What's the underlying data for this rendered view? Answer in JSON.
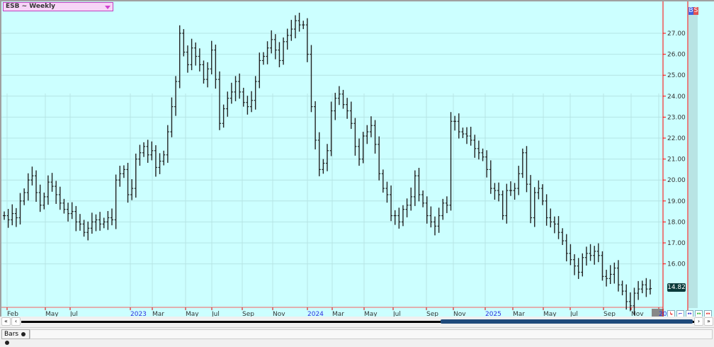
{
  "header": {
    "title": "ESB ~ Weekly",
    "buy_label": "B",
    "sell_label": "S"
  },
  "colors": {
    "background": "#ccffff",
    "bars": "#222222",
    "grid": "#b4e4e4",
    "cursor_line": "#ff0000",
    "last_price_bg": "#0b3b3b"
  },
  "chart_data": {
    "type": "ohlc-bar",
    "title": "ESB ~ Weekly",
    "ylim": [
      13.5,
      28.5
    ],
    "y_ticks": [
      "16.00",
      "17.00",
      "18.00",
      "19.00",
      "20.00",
      "21.00",
      "22.00",
      "23.00",
      "24.00",
      "25.00",
      "26.00",
      "27.00"
    ],
    "last_price": "14.82",
    "x_ticks": [
      {
        "label": "Feb",
        "year": false
      },
      {
        "label": "May",
        "year": false
      },
      {
        "label": "Jul",
        "year": false
      },
      {
        "label": "2023",
        "year": true
      },
      {
        "label": "Mar",
        "year": false
      },
      {
        "label": "May",
        "year": false
      },
      {
        "label": "Jul",
        "year": false
      },
      {
        "label": "Sep",
        "year": false
      },
      {
        "label": "Nov",
        "year": false
      },
      {
        "label": "2024",
        "year": true
      },
      {
        "label": "Mar",
        "year": false
      },
      {
        "label": "May",
        "year": false
      },
      {
        "label": "Jul",
        "year": false
      },
      {
        "label": "Sep",
        "year": false
      },
      {
        "label": "Nov",
        "year": false
      },
      {
        "label": "2025",
        "year": true
      },
      {
        "label": "Mar",
        "year": false
      },
      {
        "label": "May",
        "year": false
      },
      {
        "label": "Jul",
        "year": false
      },
      {
        "label": "Sep",
        "year": false
      },
      {
        "label": "Nov",
        "year": false
      },
      {
        "label": "20",
        "year": true
      }
    ],
    "closes": [
      18.3,
      18.1,
      18.4,
      18.2,
      19.0,
      19.4,
      20.0,
      20.2,
      19.4,
      18.8,
      19.2,
      19.9,
      19.7,
      19.3,
      18.9,
      18.6,
      18.4,
      18.5,
      18.0,
      17.9,
      17.5,
      17.7,
      18.0,
      18.1,
      17.9,
      18.0,
      18.2,
      18.1,
      20.0,
      20.3,
      20.5,
      19.3,
      19.6,
      21.0,
      21.3,
      21.6,
      21.2,
      21.4,
      20.6,
      20.9,
      21.2,
      22.3,
      23.5,
      24.7,
      27.0,
      26.1,
      25.5,
      26.3,
      25.9,
      25.5,
      24.8,
      25.3,
      26.2,
      24.8,
      22.7,
      23.4,
      23.9,
      24.2,
      24.7,
      24.2,
      23.7,
      23.5,
      23.8,
      24.7,
      25.7,
      25.9,
      26.3,
      26.7,
      26.2,
      25.7,
      26.6,
      26.9,
      27.2,
      27.6,
      27.4,
      27.4,
      26.0,
      23.5,
      21.9,
      20.5,
      20.8,
      21.4,
      23.3,
      23.9,
      24.1,
      23.6,
      23.3,
      22.7,
      21.6,
      21.0,
      22.1,
      22.3,
      22.6,
      21.7,
      20.3,
      19.6,
      19.3,
      18.3,
      18.3,
      18.0,
      18.6,
      18.8,
      19.2,
      20.2,
      19.3,
      18.9,
      18.3,
      18.0,
      17.8,
      18.3,
      18.9,
      18.8,
      22.8,
      22.8,
      22.3,
      22.2,
      22.1,
      21.9,
      21.5,
      21.3,
      21.1,
      20.5,
      19.6,
      19.5,
      19.3,
      18.3,
      19.5,
      19.5,
      19.6,
      20.3,
      21.3,
      19.8,
      18.2,
      19.4,
      19.6,
      19.0,
      18.2,
      18.0,
      17.9,
      17.5,
      17.1,
      16.5,
      16.2,
      15.9,
      15.6,
      16.3,
      16.5,
      16.4,
      16.6,
      16.4,
      15.4,
      15.3,
      15.5,
      15.8,
      15.0,
      14.7,
      14.2,
      14.0,
      14.6,
      14.8,
      15.0,
      14.8,
      14.82
    ]
  },
  "status": {
    "tab_label": "Bars"
  },
  "scroll": {
    "first": "«",
    "prev": "‹",
    "next": "›",
    "last": "»"
  }
}
